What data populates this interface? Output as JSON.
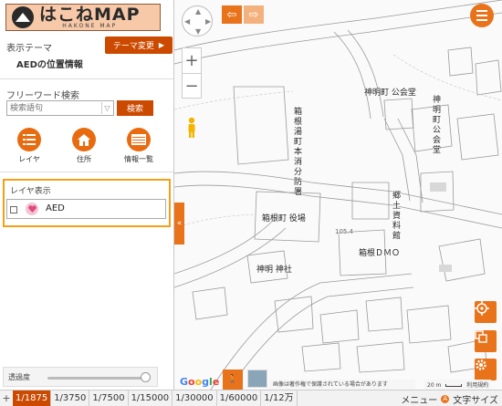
{
  "app": {
    "logo_text": "はこねMAP",
    "logo_sub": "HAKONE MAP"
  },
  "panel": {
    "theme_label": "表示テーマ",
    "theme_button": "テーマ変更",
    "theme_name": "AEDの位置情報",
    "freeword_label": "フリーワード検索",
    "search_placeholder": "検索語句",
    "search_button": "検索",
    "tools": [
      {
        "label": "レイヤ",
        "icon": "list-icon"
      },
      {
        "label": "住所",
        "icon": "home-icon"
      },
      {
        "label": "情報一覧",
        "icon": "table-icon"
      }
    ],
    "layer_title": "レイヤ表示",
    "layer_item": "AED",
    "opacity_label": "透過度",
    "opacity_value": 1.0
  },
  "map": {
    "labels": {
      "jinmeicho_kominkan": "神明町 公会堂",
      "fire_station": "箱根湯町本消分防署",
      "jinmeicho_kokaido_v": "神明町公会堂",
      "shiryokan": "郷土資料館",
      "town_hall": "箱根町 役場",
      "dmo": "箱根ＤＭＯ",
      "shrine": "神明 神社",
      "elev": "105.4"
    },
    "copyright": "画像は著作権で保護されている場合があります",
    "scale_text": "20 m",
    "terms": "利用規約",
    "google": "Google"
  },
  "bottom": {
    "scales": [
      "1/1875",
      "1/3750",
      "1/7500",
      "1/15000",
      "1/30000",
      "1/60000",
      "1/12万"
    ],
    "active_scale": "1/1875",
    "menu": "メニュー",
    "font_size": "文字サイズ",
    "font_icon": "A"
  },
  "colors": {
    "accent": "#e8731b",
    "accent_dark": "#cc4a00",
    "highlight_border": "#f4a017"
  }
}
